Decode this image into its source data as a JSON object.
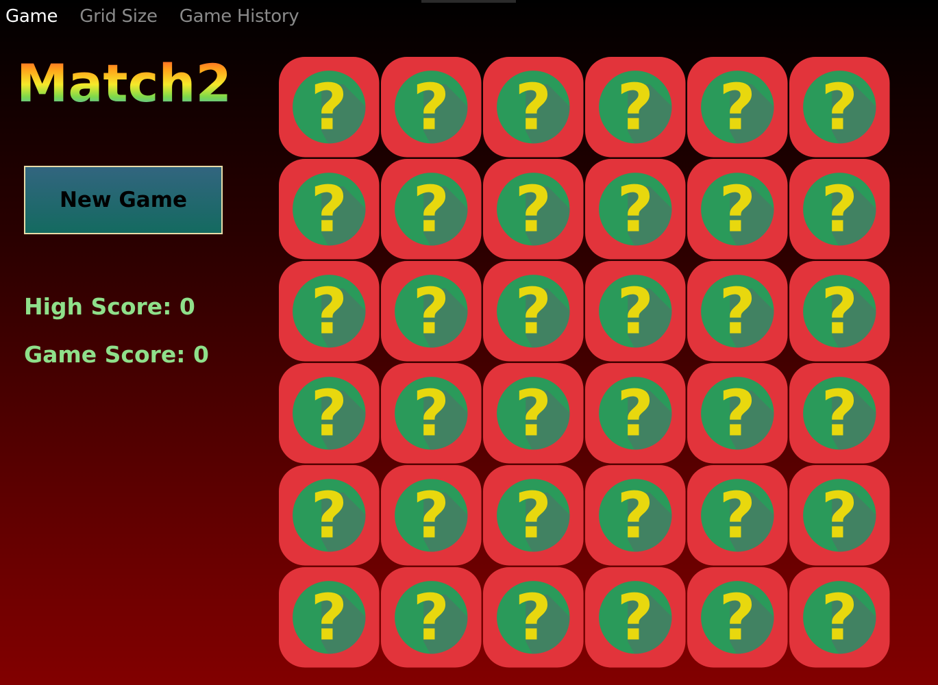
{
  "nav": {
    "tabs": [
      {
        "label": "Game",
        "active": true
      },
      {
        "label": "Grid Size",
        "active": false
      },
      {
        "label": "Game History",
        "active": false
      }
    ]
  },
  "logo": {
    "text": "Match2"
  },
  "controls": {
    "new_game_label": "New Game"
  },
  "scores": {
    "high_score_label": "High Score: 0",
    "game_score_label": "Game Score: 0"
  },
  "board": {
    "rows": 6,
    "cols": 6,
    "tile_icon": "question-mark-icon",
    "tile_glyph": "?",
    "colors": {
      "tile": "#e2343b",
      "circle": "#2a9a5a",
      "glyph": "#e8d80e",
      "shadow": "#4a7a66"
    }
  },
  "colors": {
    "score_text": "#8fe08a",
    "button_border": "#e8dca8",
    "active_tab": "#ffffff",
    "inactive_tab": "#8a8a8a"
  }
}
